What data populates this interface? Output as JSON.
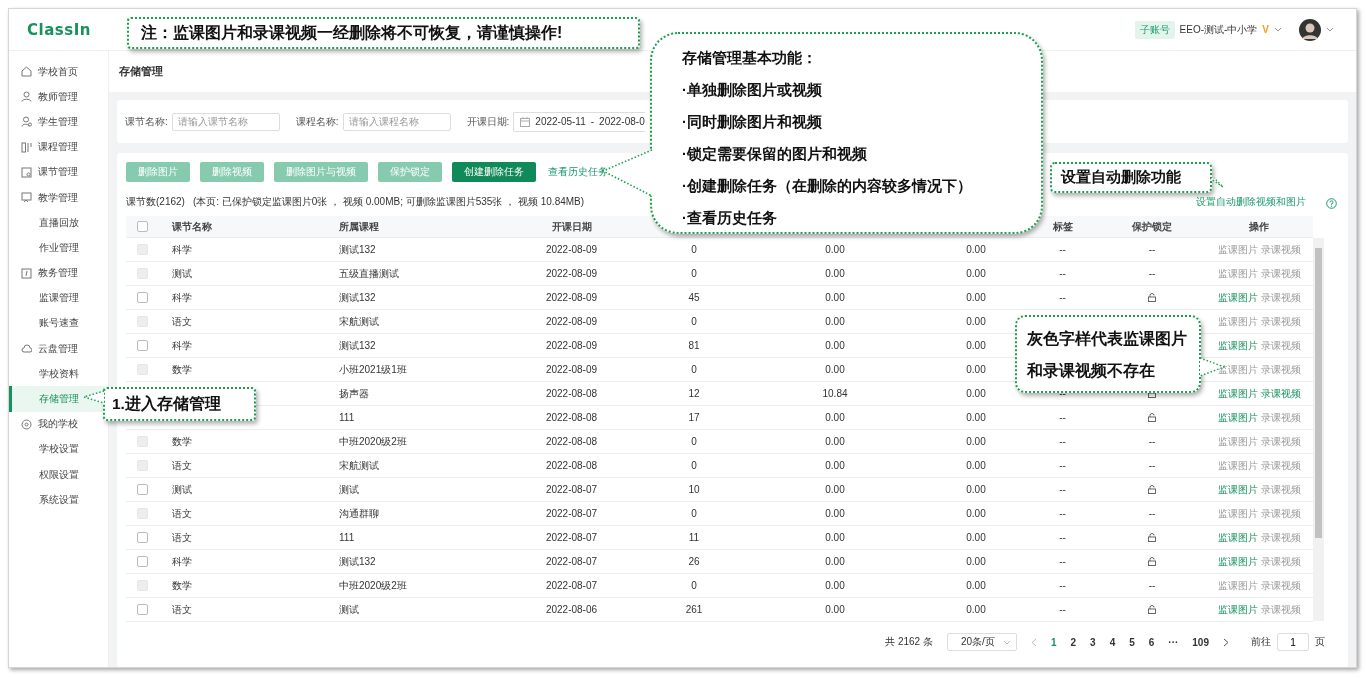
{
  "top_bar": {
    "logo": "ClassIn",
    "account_badge": "子账号",
    "school": "EEO-测试-中小学",
    "vip_mark": "V"
  },
  "sidebar": {
    "items": [
      {
        "label": "学校首页",
        "kind": "section",
        "selected": false
      },
      {
        "label": "教师管理",
        "kind": "section",
        "selected": false
      },
      {
        "label": "学生管理",
        "kind": "section",
        "selected": false
      },
      {
        "label": "课程管理",
        "kind": "section",
        "selected": false
      },
      {
        "label": "课节管理",
        "kind": "section",
        "selected": false
      },
      {
        "label": "教学管理",
        "kind": "section",
        "selected": false
      },
      {
        "label": "直播回放",
        "kind": "sub",
        "selected": false
      },
      {
        "label": "作业管理",
        "kind": "sub",
        "selected": false
      },
      {
        "label": "教务管理",
        "kind": "section",
        "selected": false
      },
      {
        "label": "监课管理",
        "kind": "sub",
        "selected": false
      },
      {
        "label": "账号速查",
        "kind": "sub",
        "selected": false
      },
      {
        "label": "云盘管理",
        "kind": "section",
        "selected": false
      },
      {
        "label": "学校资料",
        "kind": "sub",
        "selected": false
      },
      {
        "label": "存储管理",
        "kind": "sub",
        "selected": true
      },
      {
        "label": "我的学校",
        "kind": "section",
        "selected": false
      },
      {
        "label": "学校设置",
        "kind": "sub",
        "selected": false
      },
      {
        "label": "权限设置",
        "kind": "sub",
        "selected": false
      },
      {
        "label": "系统设置",
        "kind": "sub",
        "selected": false
      }
    ]
  },
  "page_title": "存储管理",
  "filters": [
    {
      "label": "课节名称:",
      "placeholder": "请输入课节名称"
    },
    {
      "label": "课程名称:",
      "placeholder": "请输入课程名称"
    }
  ],
  "date_filter": {
    "label": "开课日期:",
    "start": "2022-05-11",
    "separator": "-",
    "end": "2022-08-0"
  },
  "toolbar": {
    "buttons": [
      {
        "label": "删除图片",
        "disabled": true
      },
      {
        "label": "删除视频",
        "disabled": true
      },
      {
        "label": "删除图片与视频",
        "disabled": true
      },
      {
        "label": "保护锁定",
        "disabled": true
      },
      {
        "label": "创建删除任务",
        "disabled": false
      }
    ],
    "history_link": "查看历史任务",
    "auto_delete_link": "设置自动删除视频和图片"
  },
  "summary": {
    "count": "课节数(2162)",
    "detail": "(本页: 已保护锁定监课图片0张 ， 视频 0.00MB; 可删除监课图片535张 ， 视频 10.84MB)"
  },
  "table": {
    "select_all_checked": false,
    "columns": {
      "lesson": "课节名称",
      "course": "所属课程",
      "date": "开课日期",
      "tag": "标签",
      "lock": "保护锁定",
      "actions": "操作"
    },
    "rows": [
      {
        "disabled": true,
        "lesson": "科学",
        "course": "测试132",
        "date": "2022-08-09",
        "column_4": "0",
        "column_5": "0.00",
        "column_6": "0.00",
        "tag": "--",
        "lockable": false,
        "lock": "--",
        "actions": [
          {
            "label": "监课图片",
            "available": false
          },
          {
            "label": "录课视频",
            "available": false
          }
        ]
      },
      {
        "disabled": true,
        "lesson": "测试",
        "course": "五级直播测试",
        "date": "2022-08-09",
        "column_4": "0",
        "column_5": "0.00",
        "column_6": "0.00",
        "tag": "--",
        "lockable": false,
        "lock": "--",
        "actions": [
          {
            "label": "监课图片",
            "available": false
          },
          {
            "label": "录课视频",
            "available": false
          }
        ]
      },
      {
        "disabled": false,
        "lesson": "科学",
        "course": "测试132",
        "date": "2022-08-09",
        "column_4": "45",
        "column_5": "0.00",
        "column_6": "0.00",
        "tag": "--",
        "lockable": true,
        "actions": [
          {
            "label": "监课图片",
            "available": true
          },
          {
            "label": "录课视频",
            "available": false
          }
        ]
      },
      {
        "disabled": true,
        "lesson": "语文",
        "course": "宋航测试",
        "date": "2022-08-09",
        "column_4": "0",
        "column_5": "0.00",
        "column_6": "0.00",
        "actions": [
          {
            "label": "监课图片",
            "available": false
          },
          {
            "label": "录课视频",
            "available": false
          }
        ]
      },
      {
        "disabled": false,
        "lesson": "科学",
        "course": "测试132",
        "date": "2022-08-09",
        "column_4": "81",
        "column_5": "0.00",
        "column_6": "0.00",
        "actions": [
          {
            "label": "监课图片",
            "available": true
          },
          {
            "label": "录课视频",
            "available": false
          }
        ]
      },
      {
        "disabled": true,
        "lesson": "数学",
        "course": "小班2021级1班",
        "date": "2022-08-09",
        "column_4": "0",
        "column_5": "0.00",
        "column_6": "0.00",
        "actions": [
          {
            "label": "监课图片",
            "available": false
          },
          {
            "label": "录课视频",
            "available": false
          }
        ]
      },
      {
        "course": "扬声器",
        "date": "2022-08-08",
        "column_4": "12",
        "column_5": "10.84",
        "column_6": "0.00",
        "tag": "--",
        "lockable": true,
        "actions": [
          {
            "label": "监课图片",
            "available": true
          },
          {
            "label": "录课视频",
            "available": true
          }
        ]
      },
      {
        "course": "111",
        "date": "2022-08-08",
        "column_4": "17",
        "column_5": "0.00",
        "column_6": "0.00",
        "tag": "--",
        "lockable": true,
        "actions": [
          {
            "label": "监课图片",
            "available": true
          },
          {
            "label": "录课视频",
            "available": false
          }
        ]
      },
      {
        "disabled": true,
        "lesson": "数学",
        "course": "中班2020级2班",
        "date": "2022-08-08",
        "column_4": "0",
        "column_5": "0.00",
        "column_6": "0.00",
        "tag": "--",
        "lockable": false,
        "lock": "--",
        "actions": [
          {
            "label": "监课图片",
            "available": false
          },
          {
            "label": "录课视频",
            "available": false
          }
        ]
      },
      {
        "disabled": true,
        "lesson": "语文",
        "course": "宋航测试",
        "date": "2022-08-08",
        "column_4": "0",
        "column_5": "0.00",
        "column_6": "0.00",
        "tag": "--",
        "lockable": false,
        "lock": "--",
        "actions": [
          {
            "label": "监课图片",
            "available": false
          },
          {
            "label": "录课视频",
            "available": false
          }
        ]
      },
      {
        "disabled": false,
        "lesson": "测试",
        "course": "测试",
        "date": "2022-08-07",
        "column_4": "10",
        "column_5": "0.00",
        "column_6": "0.00",
        "tag": "--",
        "lockable": true,
        "actions": [
          {
            "label": "监课图片",
            "available": true
          },
          {
            "label": "录课视频",
            "available": false
          }
        ]
      },
      {
        "disabled": true,
        "lesson": "语文",
        "course": "沟通群聊",
        "date": "2022-08-07",
        "column_4": "0",
        "column_5": "0.00",
        "column_6": "0.00",
        "tag": "--",
        "lockable": false,
        "lock": "--",
        "actions": [
          {
            "label": "监课图片",
            "available": false
          },
          {
            "label": "录课视频",
            "available": false
          }
        ]
      },
      {
        "disabled": false,
        "lesson": "语文",
        "course": "111",
        "date": "2022-08-07",
        "column_4": "11",
        "column_5": "0.00",
        "column_6": "0.00",
        "tag": "--",
        "lockable": true,
        "actions": [
          {
            "label": "监课图片",
            "available": true
          },
          {
            "label": "录课视频",
            "available": false
          }
        ]
      },
      {
        "disabled": false,
        "lesson": "科学",
        "course": "测试132",
        "date": "2022-08-07",
        "column_4": "26",
        "column_5": "0.00",
        "column_6": "0.00",
        "tag": "--",
        "lockable": true,
        "actions": [
          {
            "label": "监课图片",
            "available": true
          },
          {
            "label": "录课视频",
            "available": false
          }
        ]
      },
      {
        "disabled": true,
        "lesson": "数学",
        "course": "中班2020级2班",
        "date": "2022-08-07",
        "column_4": "0",
        "column_5": "0.00",
        "column_6": "0.00",
        "tag": "--",
        "lockable": false,
        "lock": "--",
        "actions": [
          {
            "label": "监课图片",
            "available": false
          },
          {
            "label": "录课视频",
            "available": false
          }
        ]
      },
      {
        "disabled": false,
        "lesson": "语文",
        "course": "测试",
        "date": "2022-08-06",
        "column_4": "261",
        "column_5": "0.00",
        "column_6": "0.00",
        "tag": "--",
        "lockable": true,
        "actions": [
          {
            "label": "监课图片",
            "available": true
          },
          {
            "label": "录课视频",
            "available": false
          }
        ]
      }
    ]
  },
  "pagination": {
    "total": "共 2162 条",
    "page_size": "20条/页",
    "pages": [
      {
        "label": "1",
        "selected": true
      },
      {
        "label": "2",
        "selected": false
      },
      {
        "label": "3",
        "selected": false
      },
      {
        "label": "4",
        "selected": false
      },
      {
        "label": "5",
        "selected": false
      },
      {
        "label": "6",
        "selected": false
      },
      {
        "label": "···",
        "selected": false
      },
      {
        "label": "109",
        "selected": false
      }
    ],
    "goto_label": "前往",
    "goto_value": "1",
    "goto_suffix": "页"
  },
  "callouts": {
    "warning": "注：监课图片和录课视频一经删除将不可恢复，请谨慎操作!",
    "features_title": "存储管理基本功能：",
    "features": [
      "·单独删除图片或视频",
      "·同时删除图片和视频",
      "·锁定需要保留的图片和视频",
      "·创建删除任务（在删除的内容较多情况下）",
      "·查看历史任务"
    ],
    "auto_delete": "设置自动删除功能",
    "grey_text": "灰色字样代表监课图片和录课视频不存在",
    "enter": "1.进入存储管理"
  }
}
